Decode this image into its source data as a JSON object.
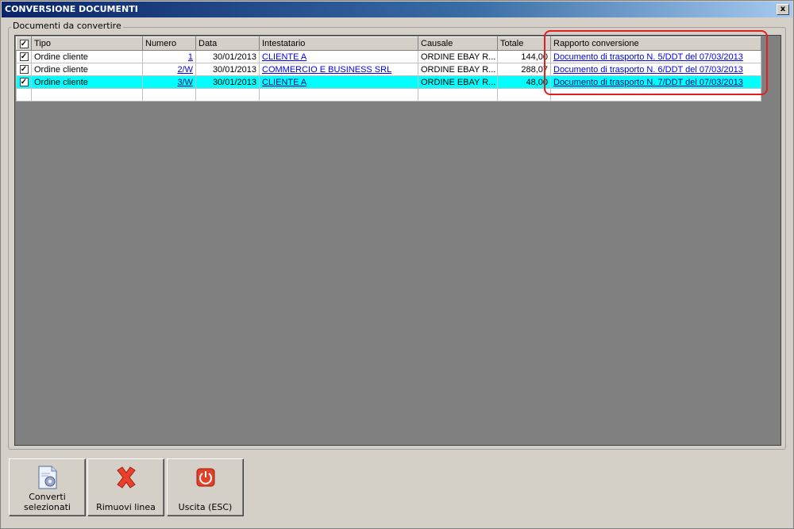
{
  "window": {
    "title": "CONVERSIONE DOCUMENTI",
    "close_glyph": "x"
  },
  "group": {
    "label": "Documenti da convertire"
  },
  "grid": {
    "headers": {
      "tipo": "Tipo",
      "numero": "Numero",
      "data": "Data",
      "intestatario": "Intestatario",
      "causale": "Causale",
      "totale": "Totale",
      "rapporto": "Rapporto conversione"
    },
    "rows": [
      {
        "checked": "✓",
        "tipo": "Ordine cliente",
        "numero": "1",
        "data": "30/01/2013",
        "intestatario": "CLIENTE A",
        "causale": "ORDINE EBAY R...",
        "totale": "144,00",
        "rapporto": "Documento di trasporto N. 5/DDT del 07/03/2013"
      },
      {
        "checked": "✓",
        "tipo": "Ordine cliente",
        "numero": "2/W",
        "data": "30/01/2013",
        "intestatario": "COMMERCIO E BUSINESS SRL",
        "causale": "ORDINE EBAY R...",
        "totale": "288,07",
        "rapporto": "Documento di trasporto N. 6/DDT del 07/03/2013"
      },
      {
        "checked": "✓",
        "tipo": "Ordine cliente",
        "numero": "3/W",
        "data": "30/01/2013",
        "intestatario": "CLIENTE A",
        "causale": "ORDINE EBAY R...",
        "totale": "48,00",
        "rapporto": "Documento di trasporto N. 7/DDT del 07/03/2013"
      }
    ],
    "header_check": "✓",
    "selected_row_color": "#00ffff"
  },
  "buttons": {
    "converti": {
      "label": "Converti selezionati",
      "icon": "document-gear-icon"
    },
    "rimuovi": {
      "label": "Rimuovi linea",
      "icon": "red-x-icon"
    },
    "uscita": {
      "label": "Uscita (ESC)",
      "icon": "power-icon"
    }
  },
  "annotation_color": "#e02020"
}
